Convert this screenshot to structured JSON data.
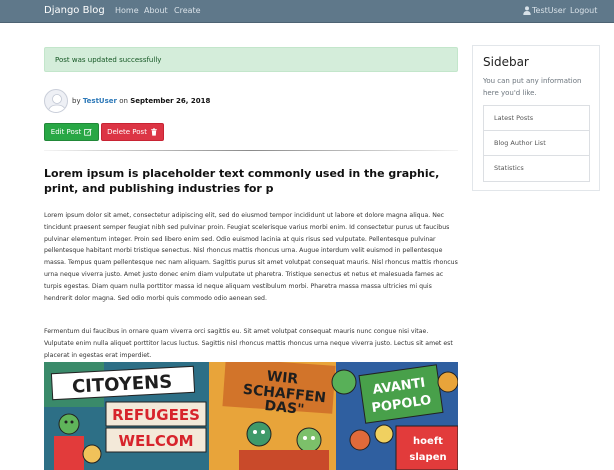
{
  "navbar": {
    "brand": "Django Blog",
    "links": [
      "Home",
      "About",
      "Create"
    ],
    "user": "TestUser",
    "logout": "Logout"
  },
  "alert": {
    "message": "Post was updated successfully"
  },
  "post": {
    "by_prefix": "by",
    "author": "TestUser",
    "on_text": "on",
    "date": "September 26, 2018",
    "edit_label": "Edit Post",
    "delete_label": "Delete Post",
    "title": "Lorem ipsum is placeholder text commonly used in the graphic, print, and publishing industries for p",
    "paragraph1": "Lorem ipsum dolor sit amet, consectetur adipiscing elit, sed do eiusmod tempor incididunt ut labore et dolore magna aliqua. Nec tincidunt praesent semper feugiat nibh sed pulvinar proin. Feugiat scelerisque varius morbi enim. Id consectetur purus ut faucibus pulvinar elementum integer. Proin sed libero enim sed. Odio euismod lacinia at quis risus sed vulputate. Pellentesque pulvinar pellentesque habitant morbi tristique senectus. Nisl rhoncus mattis rhoncus urna. Augue interdum velit euismod in pellentesque massa. Tempus quam pellentesque nec nam aliquam. Sagittis purus sit amet volutpat consequat mauris. Nisl rhoncus mattis rhoncus urna neque viverra justo. Amet justo donec enim diam vulputate ut pharetra. Tristique senectus et netus et malesuada fames ac turpis egestas. Diam quam nulla porttitor massa id neque aliquam vestibulum morbi. Pharetra massa massa ultricies mi quis hendrerit dolor magna. Sed odio morbi quis commodo odio aenean sed.",
    "paragraph2": "Fermentum dui faucibus in ornare quam viverra orci sagittis eu. Sit amet volutpat consequat mauris nunc congue nisi vitae. Vulputate enim nulla aliquet porttitor lacus luctus. Sagittis nisl rhoncus mattis rhoncus urna neque viverra justo. Lectus sit amet est placerat in egestas erat imperdiet."
  },
  "image_text": {
    "sign_left": "CITOYENS",
    "sign_refugees": "REFUGEES",
    "sign_welcome": "WELCOM",
    "sign_wir": "WIR",
    "sign_schaffen": "SCHAFFEN",
    "sign_das": "DAS\"",
    "sign_avanti": "AVANTI",
    "sign_popolo": "POPOLO",
    "sign_hoeft": "hoeft",
    "sign_slapen": "slapen"
  },
  "sidebar": {
    "title": "Sidebar",
    "text": "You can put any information here you'd like.",
    "items": [
      "Latest Posts",
      "Blog Author List",
      "Statistics"
    ]
  }
}
